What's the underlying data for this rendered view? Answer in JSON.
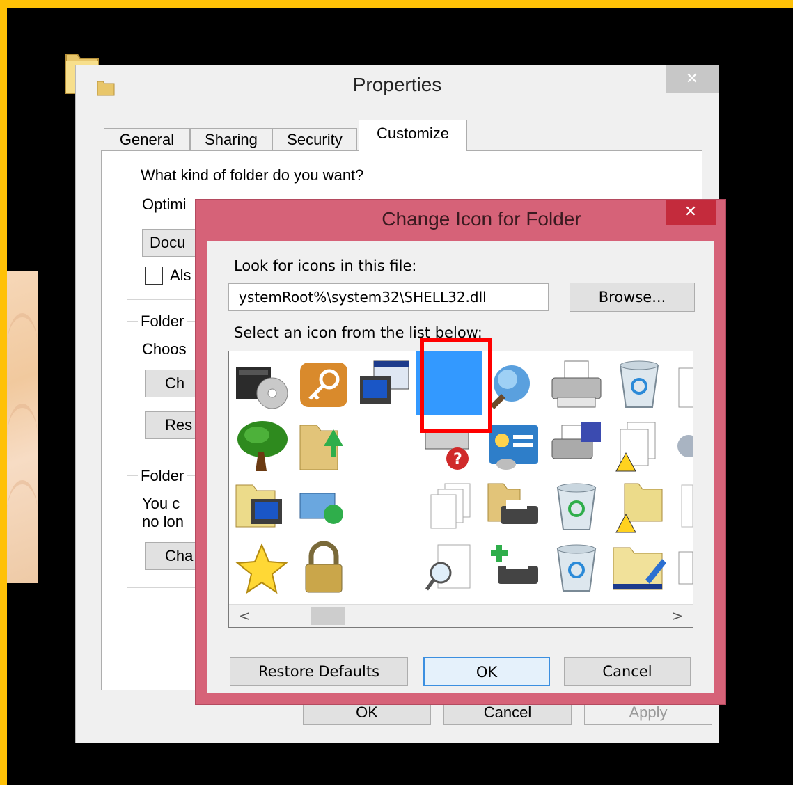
{
  "properties": {
    "title": "Properties",
    "close_label": "✕",
    "tabs": [
      "General",
      "Sharing",
      "Security",
      "Customize"
    ],
    "group1_label": "What kind of folder do you want?",
    "optimize_text": "Optimi",
    "combo_value": "Docu",
    "also_text": "Als",
    "group2_label": "Folder",
    "choose_text": "Choos",
    "choose_btn": "Ch",
    "restore_btn": "Res",
    "group3_label": "Folder",
    "you_can_text": "You c",
    "no_longer_text": "no lon",
    "change_btn": "Cha",
    "ok": "OK",
    "cancel": "Cancel",
    "apply": "Apply"
  },
  "dialog": {
    "title": "Change Icon for   Folder",
    "close_label": "✕",
    "look_label": "Look for icons in this file:",
    "path_value": "ystemRoot%\\system32\\SHELL32.dll",
    "browse": "Browse...",
    "select_label": "Select an icon from the list below:",
    "restore_defaults": "Restore Defaults",
    "ok": "OK",
    "cancel": "Cancel",
    "scroll_left": "<",
    "scroll_right": ">"
  },
  "icons": [
    "disc-drive-icon",
    "key-icon",
    "computer-window-icon",
    "selected-blank-icon",
    "magnifier-globe-icon",
    "printer-icon",
    "recycle-bin-empty-icon",
    "document-partial-icon",
    "tree-icon",
    "folder-arrow-icon",
    "printer-help-icon",
    "control-panel-icon",
    "printer-disk-icon",
    "document-warning-icon",
    "gear-partial-icon",
    "folder-computer-icon",
    "network-sync-icon",
    "documents-stack-icon",
    "folder-printer-icon",
    "recycle-bin-full-icon",
    "folder-warning-icon",
    "list-partial-icon",
    "star-icon",
    "padlock-icon",
    "search-document-icon",
    "add-printer-icon",
    "recycle-bin-icon",
    "folder-edit-icon",
    "settings-partial-icon"
  ],
  "colors": {
    "border": "#ffc107",
    "dialog_frame": "#d66278",
    "selection": "#3399ff",
    "highlight": "#ff0000"
  }
}
